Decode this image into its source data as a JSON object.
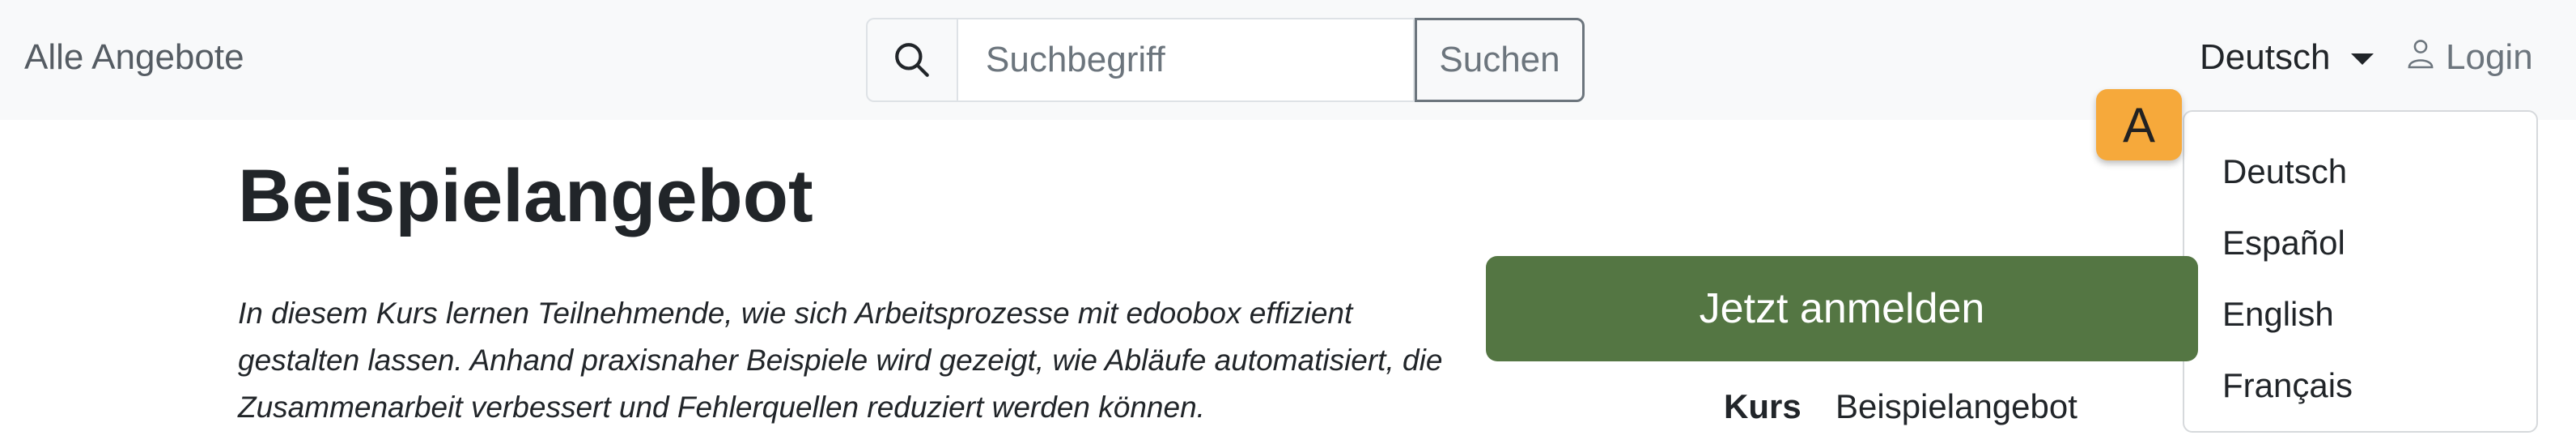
{
  "navbar": {
    "brand": "Alle Angebote",
    "search": {
      "icon": "search-icon",
      "placeholder": "Suchbegriff",
      "value": "",
      "button_label": "Suchen"
    },
    "language": {
      "selected": "Deutsch",
      "options": [
        "Deutsch",
        "Español",
        "English",
        "Français"
      ]
    },
    "login": {
      "icon": "user-icon",
      "label": "Login"
    }
  },
  "annotation_badge": "A",
  "main": {
    "title": "Beispielangebot",
    "description": "In diesem Kurs lernen Teilnehmende, wie sich Arbeitsprozesse mit edoobox effizient gestalten lassen. Anhand praxisnaher Beispiele wird gezeigt, wie Abläufe automatisiert, die Zusammenarbeit verbessert und Fehlerquellen reduziert werden können.",
    "enroll_button": "Jetzt anmelden",
    "details": {
      "course_label": "Kurs",
      "course_value": "Beispielangebot"
    }
  },
  "colors": {
    "navbar_bg": "#f8f9fa",
    "primary_button": "#547643",
    "badge": "#f6a93b"
  }
}
